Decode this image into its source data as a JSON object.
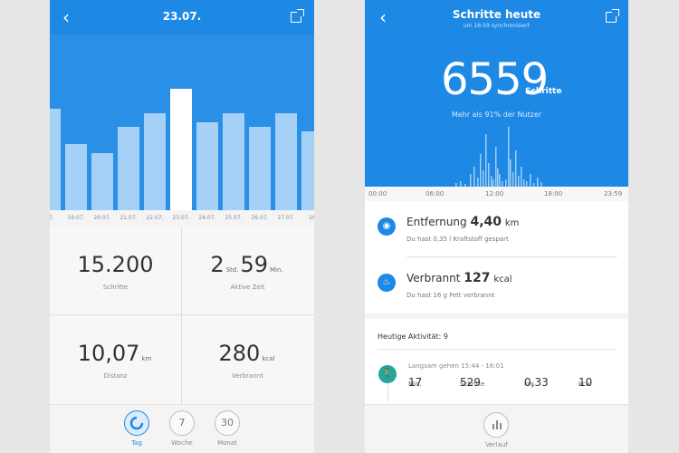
{
  "colors": {
    "accent": "#1e88e5",
    "bar": "#a6d1f6",
    "bar_selected": "#ffffff",
    "walk": "#26a69a"
  },
  "left": {
    "header": {
      "back_icon": "chevron-left-icon",
      "title": "23.07.",
      "share_icon": "share-icon"
    },
    "chart_data": {
      "type": "bar",
      "categories": [
        "18.07.",
        "19.07.",
        "20.07.",
        "21.07.",
        "22.07.",
        "23.07.",
        "24.07.",
        "25.07.",
        "26.07.",
        "27.07.",
        "28.07."
      ],
      "values": [
        11500,
        7500,
        6500,
        9500,
        11000,
        13800,
        10000,
        11000,
        9500,
        11000,
        9000
      ],
      "selected": "23.07.",
      "ylim": [
        0,
        20000
      ]
    },
    "dates": [
      "07.",
      "19.07.",
      "20.07.",
      "21.07.",
      "22.07.",
      "23.07.",
      "24.07.",
      "25.07.",
      "26.07.",
      "27.07.",
      "28"
    ],
    "stats": {
      "steps": {
        "value": "15.200",
        "label": "Schritte"
      },
      "active": {
        "hours": "2",
        "hours_unit": "Std.",
        "minutes": "59",
        "minutes_unit": "Min.",
        "label": "Aktive Zeit"
      },
      "distance": {
        "value": "10,07",
        "unit": "km",
        "label": "Distanz"
      },
      "burned": {
        "value": "280",
        "unit": "kcal",
        "label": "Verbrannt"
      }
    },
    "tabs": [
      {
        "icon": "day-icon",
        "label": "Tag",
        "active": true
      },
      {
        "num": "7",
        "label": "Woche"
      },
      {
        "num": "30",
        "label": "Monat"
      }
    ]
  },
  "right": {
    "header": {
      "back_icon": "chevron-left-icon",
      "title": "Schritte heute",
      "subtitle": "um 16:59 synchronisiert",
      "share_icon": "share-icon"
    },
    "steps": "6559",
    "steps_unit": "Schritte",
    "percentile": "Mehr als 91% der Nutzer",
    "time_axis": [
      "00:00",
      "06:00",
      "12:00",
      "18:00",
      "23:59"
    ],
    "distance": {
      "label": "Entfernung",
      "value": "4,40",
      "unit": "km",
      "desc": "Du hast 0,35 l Kraftstoff gespart",
      "icon": "location-pin-icon"
    },
    "burned": {
      "label": "Verbrannt",
      "value": "127",
      "unit": "kcal",
      "desc": "Du hast 16 g Fett verbrannt",
      "icon": "flame-icon"
    },
    "activity_title": "Heutige Aktivität: 9",
    "activity": {
      "title": "Langsam gehen 15:44 - 16:01",
      "minutes": "17",
      "minutes_unit": "Min.",
      "steps": "529",
      "steps_unit": "Schritte",
      "km": "0,33",
      "km_unit": "km",
      "kcal": "10",
      "kcal_unit": "kcal",
      "icon": "walking-icon"
    },
    "bottom": {
      "label": "Verlauf",
      "icon": "bar-chart-icon"
    }
  }
}
